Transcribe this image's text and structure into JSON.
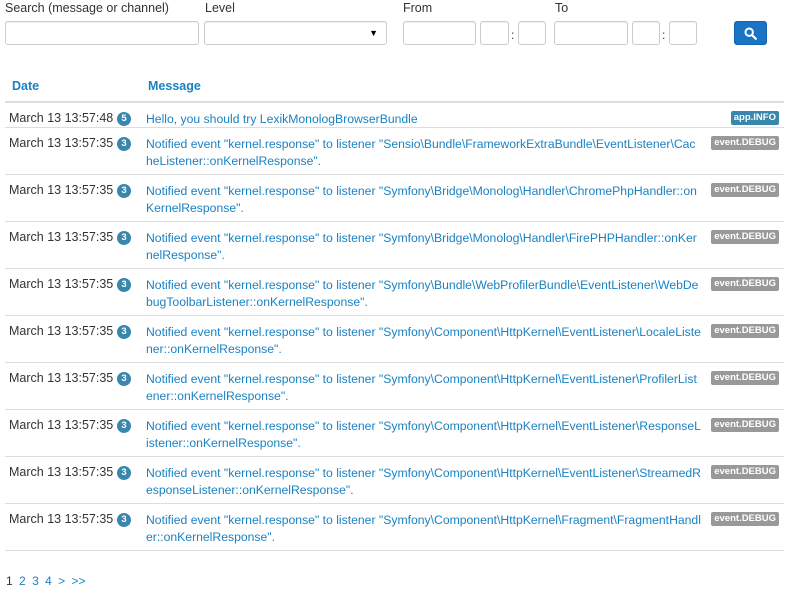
{
  "filters": {
    "search_label": "Search (message or channel)",
    "search_value": "",
    "level_label": "Level",
    "level_value": "",
    "from_label": "From",
    "to_label": "To",
    "colon": ":",
    "search_button_icon": "search-icon"
  },
  "table": {
    "headers": {
      "date": "Date",
      "message": "Message"
    },
    "rows": [
      {
        "date": "March 13 13:57:48",
        "count": "5",
        "message": "Hello, you should try LexikMonologBrowserBundle",
        "tag": "app.INFO",
        "level": "info"
      },
      {
        "date": "March 13 13:57:35",
        "count": "3",
        "message": "Notified event \"kernel.response\" to listener \"Sensio\\Bundle\\FrameworkExtraBundle\\EventListener\\CacheListener::onKernelResponse\".",
        "tag": "event.DEBUG",
        "level": "debug"
      },
      {
        "date": "March 13 13:57:35",
        "count": "3",
        "message": "Notified event \"kernel.response\" to listener \"Symfony\\Bridge\\Monolog\\Handler\\ChromePhpHandler::onKernelResponse\".",
        "tag": "event.DEBUG",
        "level": "debug"
      },
      {
        "date": "March 13 13:57:35",
        "count": "3",
        "message": "Notified event \"kernel.response\" to listener \"Symfony\\Bridge\\Monolog\\Handler\\FirePHPHandler::onKernelResponse\".",
        "tag": "event.DEBUG",
        "level": "debug"
      },
      {
        "date": "March 13 13:57:35",
        "count": "3",
        "message": "Notified event \"kernel.response\" to listener \"Symfony\\Bundle\\WebProfilerBundle\\EventListener\\WebDebugToolbarListener::onKernelResponse\".",
        "tag": "event.DEBUG",
        "level": "debug"
      },
      {
        "date": "March 13 13:57:35",
        "count": "3",
        "message": "Notified event \"kernel.response\" to listener \"Symfony\\Component\\HttpKernel\\EventListener\\LocaleListener::onKernelResponse\".",
        "tag": "event.DEBUG",
        "level": "debug"
      },
      {
        "date": "March 13 13:57:35",
        "count": "3",
        "message": "Notified event \"kernel.response\" to listener \"Symfony\\Component\\HttpKernel\\EventListener\\ProfilerListener::onKernelResponse\".",
        "tag": "event.DEBUG",
        "level": "debug"
      },
      {
        "date": "March 13 13:57:35",
        "count": "3",
        "message": "Notified event \"kernel.response\" to listener \"Symfony\\Component\\HttpKernel\\EventListener\\ResponseListener::onKernelResponse\".",
        "tag": "event.DEBUG",
        "level": "debug"
      },
      {
        "date": "March 13 13:57:35",
        "count": "3",
        "message": "Notified event \"kernel.response\" to listener \"Symfony\\Component\\HttpKernel\\EventListener\\StreamedResponseListener::onKernelResponse\".",
        "tag": "event.DEBUG",
        "level": "debug"
      },
      {
        "date": "March 13 13:57:35",
        "count": "3",
        "message": "Notified event \"kernel.response\" to listener \"Symfony\\Component\\HttpKernel\\Fragment\\FragmentHandler::onKernelResponse\".",
        "tag": "event.DEBUG",
        "level": "debug"
      }
    ]
  },
  "pagination": {
    "current": "1",
    "pages": [
      "2",
      "3",
      "4"
    ],
    "next": ">",
    "last": ">>"
  },
  "colors": {
    "link": "#1a82c3",
    "button": "#1a74c5",
    "badge_count": "#3a87ad",
    "tag_info": "#3a87ad",
    "tag_debug": "#999999"
  }
}
